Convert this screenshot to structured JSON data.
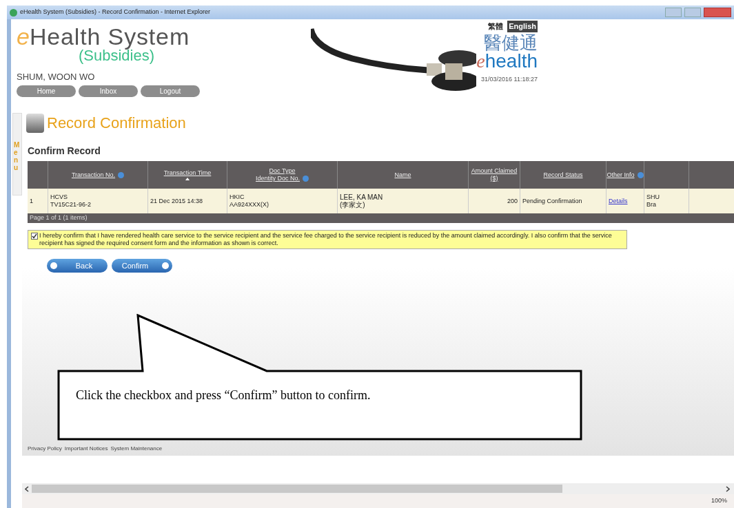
{
  "window": {
    "title": "eHealth System (Subsidies) - Record Confirmation - Internet Explorer"
  },
  "header": {
    "logo_mark": "e",
    "logo_text": "Health System",
    "logo_subtitle": "(Subsidies)",
    "user": "SHUM, WOON WO",
    "nav": [
      {
        "label": "Home"
      },
      {
        "label": "Inbox"
      },
      {
        "label": "Logout"
      }
    ],
    "languages": [
      {
        "label": "繁體",
        "selected": false
      },
      {
        "label": "English",
        "selected": true
      }
    ],
    "brand_chinese": "醫健通",
    "brand_mark": "e",
    "brand_text": "health",
    "datetime": "31/03/2016 11:18:27"
  },
  "side_menu": {
    "label": "Menu"
  },
  "page_title": "Record Confirmation",
  "section_title": "Confirm Record",
  "table": {
    "columns": [
      {
        "info": false,
        "sorted": false
      },
      {
        "label": "Transaction No.",
        "info": true,
        "sorted": false
      },
      {
        "label": "Transaction Time",
        "info": false,
        "sorted": true
      },
      {
        "label": "Doc Type\nIdentity Doc No.",
        "info": true,
        "sorted": false
      },
      {
        "label": "Name",
        "info": false,
        "sorted": false
      },
      {
        "label": "Amount Claimed ($)",
        "info": false,
        "sorted": false
      },
      {
        "label": "Record Status",
        "info": false,
        "sorted": false
      },
      {
        "label": "Other Info",
        "info": true,
        "sorted": false
      },
      {
        "info": false,
        "sorted": false
      }
    ],
    "rows": [
      {
        "cells": [
          "1",
          "HCVS\nTV15C21-96-2",
          "21 Dec 2015 14:38",
          "HKIC\nAA924XXX(X)",
          "LEE, KA MAN\n(李家文)",
          "200",
          "Pending Confirmation",
          "Details",
          "SHU\nBra"
        ]
      }
    ],
    "pager": "Page 1 of 1 (1 items)"
  },
  "declaration": {
    "checked": true,
    "text": "I hereby confirm that I have rendered health care service to the service recipient and the service fee charged to the service recipient is reduced by the amount claimed accordingly. I also confirm that the service recipient has signed the required consent form and the information as shown is correct."
  },
  "actions": [
    {
      "label": "Back",
      "kind": "back"
    },
    {
      "label": "Confirm",
      "kind": "next"
    }
  ],
  "callout": {
    "text": "Click the checkbox and press “Confirm” button to confirm."
  },
  "footer_links": [
    "Privacy Policy",
    "Important Notices",
    "System Maintenance"
  ],
  "status_bar": {
    "zoom": "100%"
  }
}
